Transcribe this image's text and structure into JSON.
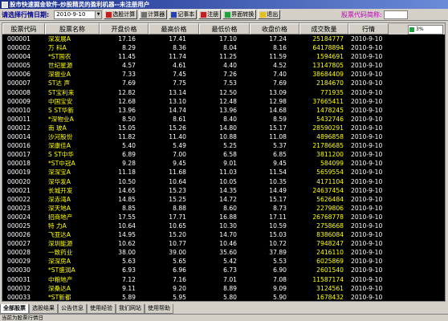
{
  "window": {
    "title": "股市快速掘金软件-炒股精灵的盈利机器--未注册用户"
  },
  "toolbar": {
    "date_label": "请选择行情日期:",
    "date_value": "2010-9-10",
    "buttons": [
      "选股计算",
      "计算器",
      "记事本",
      "注册",
      "界面转换",
      "退出"
    ]
  },
  "code_search": {
    "label": "股票代码简称:",
    "value": ""
  },
  "mini_chart": {
    "label": "3%"
  },
  "table": {
    "headers": [
      "股票代码",
      "股票名称",
      "开盘价格",
      "最高价格",
      "最低价格",
      "收盘价格",
      "成交数量",
      "行情"
    ],
    "rows": [
      [
        "000001",
        "深发展A",
        "17.16",
        "17.41",
        "17.10",
        "17.24",
        "25184777",
        "2010-9-10"
      ],
      [
        "000002",
        "万 科A",
        "8.29",
        "8.36",
        "8.04",
        "8.16",
        "64178894",
        "2010-9-10"
      ],
      [
        "000004",
        "*ST国农",
        "11.45",
        "11.74",
        "11.25",
        "11.59",
        "1594691",
        "2010-9-10"
      ],
      [
        "000005",
        "世纪星源",
        "4.57",
        "4.61",
        "4.40",
        "4.52",
        "13147805",
        "2010-9-10"
      ],
      [
        "000006",
        "深振业A",
        "7.33",
        "7.45",
        "7.26",
        "7.40",
        "38684409",
        "2010-9-10"
      ],
      [
        "000007",
        "ST达 声",
        "7.69",
        "7.75",
        "7.53",
        "7.69",
        "2184670",
        "2010-9-10"
      ],
      [
        "000008",
        "ST宝利来",
        "12.82",
        "13.14",
        "12.50",
        "13.09",
        "771935",
        "2010-9-10"
      ],
      [
        "000009",
        "中国宝安",
        "12.68",
        "13.10",
        "12.48",
        "12.98",
        "37665411",
        "2010-9-10"
      ],
      [
        "000010",
        "S ST华新",
        "13.96",
        "14.74",
        "13.96",
        "14.68",
        "1478245",
        "2010-9-10"
      ],
      [
        "000011",
        "*深物业A",
        "8.50",
        "8.61",
        "8.40",
        "8.59",
        "5432746",
        "2010-9-10"
      ],
      [
        "000012",
        "南 玻A",
        "15.05",
        "15.26",
        "14.80",
        "15.17",
        "28590291",
        "2010-9-10"
      ],
      [
        "000014",
        "沙河股份",
        "11.82",
        "11.40",
        "10.88",
        "11.08",
        "4896858",
        "2010-9-10"
      ],
      [
        "000016",
        "深康佳A",
        "5.40",
        "5.49",
        "5.25",
        "5.37",
        "21786685",
        "2010-9-10"
      ],
      [
        "000017",
        "S ST中华",
        "6.89",
        "7.00",
        "6.58",
        "6.85",
        "3811200",
        "2010-9-10"
      ],
      [
        "000018",
        "*ST中冠A",
        "9.28",
        "9.45",
        "9.01",
        "9.45",
        "584099",
        "2010-9-10"
      ],
      [
        "000019",
        "深深宝A",
        "11.18",
        "11.68",
        "11.03",
        "11.54",
        "5659554",
        "2010-9-10"
      ],
      [
        "000020",
        "深华发A",
        "10.50",
        "10.64",
        "10.05",
        "10.35",
        "4171104",
        "2010-9-10"
      ],
      [
        "000021",
        "长城开发",
        "14.65",
        "15.23",
        "14.35",
        "14.49",
        "24637454",
        "2010-9-10"
      ],
      [
        "000022",
        "深赤湾A",
        "14.85",
        "15.25",
        "14.72",
        "15.17",
        "5626484",
        "2010-9-10"
      ],
      [
        "000023",
        "深天地A",
        "8.85",
        "8.88",
        "8.60",
        "8.73",
        "2279806",
        "2010-9-10"
      ],
      [
        "000024",
        "招商地产",
        "17.55",
        "17.71",
        "16.88",
        "17.11",
        "26768778",
        "2010-9-10"
      ],
      [
        "000025",
        "特 力A",
        "10.64",
        "10.65",
        "10.30",
        "10.59",
        "2758668",
        "2010-9-10"
      ],
      [
        "000026",
        "飞亚达A",
        "14.95",
        "15.20",
        "14.70",
        "15.03",
        "8386084",
        "2010-9-10"
      ],
      [
        "000027",
        "深圳能源",
        "10.62",
        "10.77",
        "10.46",
        "10.72",
        "7948247",
        "2010-9-10"
      ],
      [
        "000028",
        "一致药业",
        "38.00",
        "39.00",
        "35.60",
        "37.89",
        "2416110",
        "2010-9-10"
      ],
      [
        "000029",
        "深深房A",
        "5.63",
        "5.65",
        "5.42",
        "5.53",
        "6025869",
        "2010-9-10"
      ],
      [
        "000030",
        "*ST盛润A",
        "6.93",
        "6.96",
        "6.73",
        "6.90",
        "2601540",
        "2010-9-10"
      ],
      [
        "000031",
        "中粮地产",
        "7.12",
        "7.16",
        "7.01",
        "7.08",
        "11587174",
        "2010-9-10"
      ],
      [
        "000032",
        "深桑达A",
        "9.11",
        "9.20",
        "8.89",
        "9.09",
        "3124561",
        "2010-9-10"
      ],
      [
        "000033",
        "*ST新都",
        "5.89",
        "5.95",
        "5.80",
        "5.90",
        "1678432",
        "2010-9-10"
      ]
    ]
  },
  "tabs": [
    "全部股票",
    "选股结果",
    "公告信息",
    "使用经验",
    "我们网站",
    "使用帮助"
  ],
  "active_tab": 0,
  "status": {
    "text": "当前为股票行情日"
  }
}
